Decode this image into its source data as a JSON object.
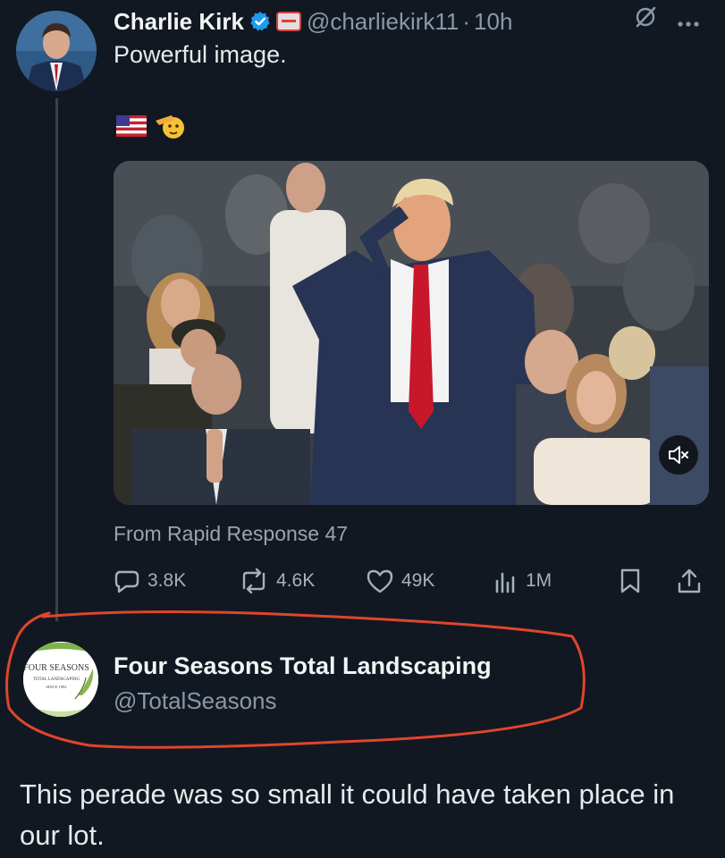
{
  "tweet": {
    "author_name": "Charlie Kirk",
    "handle": "@charliekirk11",
    "separator": "·",
    "time": "10h",
    "text": "Powerful image.",
    "emojis": [
      "flag-us-icon",
      "saluting-face-icon"
    ],
    "media_source": "From Rapid Response 47",
    "stats": {
      "replies": "3.8K",
      "reposts": "4.6K",
      "likes": "49K",
      "views": "1M"
    },
    "colors": {
      "background": "#111821",
      "verified": "#1d9bf0",
      "secondary_text": "#8b98a5"
    }
  },
  "reply": {
    "name": "Four Seasons Total Landscaping",
    "handle": "@TotalSeasons",
    "avatar_logo": {
      "title": "FOUR SEASONS",
      "subtitle": "TOTAL LANDSCAPING",
      "since": "SINCE 1992"
    },
    "text": "This perade was so small it could have taken place in our lot.",
    "annotation_color": "#e0452d"
  }
}
